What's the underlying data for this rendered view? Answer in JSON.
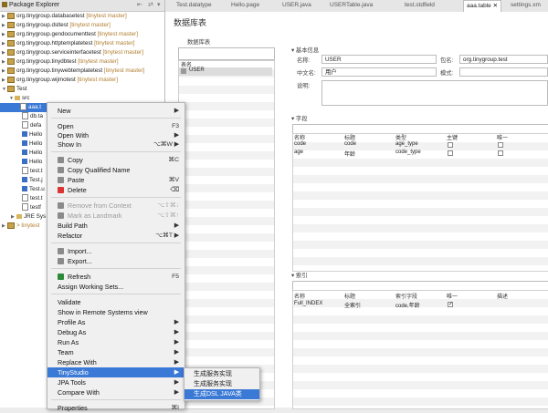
{
  "package_explorer": {
    "title": "Package Explorer",
    "rows": [
      {
        "name": "org.tinygroup.databasetest",
        "branch": "[tinytest master]"
      },
      {
        "name": "org.tinygroup.dsltest",
        "branch": "[tinytest master]"
      },
      {
        "name": "org.tinygroup.gendocumenttest",
        "branch": "[tinytest master]"
      },
      {
        "name": "org.tinygroup.httptemplatetest",
        "branch": "[tinytest master]"
      },
      {
        "name": "org.tinygroup.serviceinterfacetest",
        "branch": "[tinytest master]"
      },
      {
        "name": "org.tinygroup.tinydbtest",
        "branch": "[tinytest master]"
      },
      {
        "name": "org.tinygroup.tinywebtemplatetest",
        "branch": "[tinytest master]"
      },
      {
        "name": "org.tinygroup.wijmotest",
        "branch": "[tinytest master]"
      }
    ],
    "test_project": "Test",
    "src_folder": "src",
    "selected_file": "aaa.t",
    "children": [
      "db.ta",
      "defa",
      "Hello",
      "Hello",
      "Hello",
      "Hello",
      "test.t",
      "Test.j",
      "Test.u",
      "test.t",
      "testf"
    ],
    "jre": "JRE Sys",
    "tinytest": "> tinytest"
  },
  "editor_tabs": [
    "Test.datatype",
    "Hello.page",
    "USER.java",
    "USERTable.java",
    "test.stdfield",
    "aaa.table",
    "settings.xm"
  ],
  "editor": {
    "title": "数据库表",
    "left_section": "数据库表",
    "list_header": "表名",
    "list_item": "USER",
    "basic_section": "基本信息",
    "name_label": "名称:",
    "name_value": "USER",
    "package_label": "包名:",
    "package_value": "org.tinygroup.test",
    "cn_label": "中文名:",
    "cn_value": "用户",
    "mode_label": "模式:",
    "desc_label": "说明:",
    "field_section": "字段",
    "field_columns": [
      "名称",
      "标题",
      "类型",
      "主键",
      "唯一"
    ],
    "field_rows": [
      {
        "name": "code",
        "title": "code",
        "type": "age_type"
      },
      {
        "name": "age",
        "title": "年龄",
        "type": "code_type"
      }
    ],
    "index_section": "索引",
    "index_columns": [
      "名称",
      "标题",
      "索引字段",
      "唯一",
      "描述"
    ],
    "index_rows": [
      {
        "name": "Full_INDEX",
        "title": "全索引",
        "fields": "code,年龄"
      }
    ]
  },
  "context_menu": {
    "items": [
      {
        "label": "New",
        "shortcut": "▶"
      },
      {
        "label": "Open",
        "shortcut": "F3"
      },
      {
        "label": "Open With",
        "shortcut": "▶"
      },
      {
        "label": "Show In",
        "shortcut": "⌥⌘W ▶"
      },
      {
        "label": "Copy",
        "shortcut": "⌘C"
      },
      {
        "label": "Copy Qualified Name",
        "shortcut": ""
      },
      {
        "label": "Paste",
        "shortcut": "⌘V"
      },
      {
        "label": "Delete",
        "shortcut": "⌫"
      },
      {
        "label": "Remove from Context",
        "shortcut": "⌥⇧⌘↓"
      },
      {
        "label": "Mark as Landmark",
        "shortcut": "⌥⇧⌘↑"
      },
      {
        "label": "Build Path",
        "shortcut": "▶"
      },
      {
        "label": "Refactor",
        "shortcut": "⌥⌘T ▶"
      },
      {
        "label": "Import...",
        "shortcut": ""
      },
      {
        "label": "Export...",
        "shortcut": ""
      },
      {
        "label": "Refresh",
        "shortcut": "F5"
      },
      {
        "label": "Assign Working Sets...",
        "shortcut": ""
      },
      {
        "label": "Validate",
        "shortcut": ""
      },
      {
        "label": "Show in Remote Systems view",
        "shortcut": ""
      },
      {
        "label": "Profile As",
        "shortcut": "▶"
      },
      {
        "label": "Debug As",
        "shortcut": "▶"
      },
      {
        "label": "Run As",
        "shortcut": "▶"
      },
      {
        "label": "Team",
        "shortcut": "▶"
      },
      {
        "label": "Replace With",
        "shortcut": "▶"
      },
      {
        "label": "TinyStudio",
        "shortcut": "▶"
      },
      {
        "label": "JPA Tools",
        "shortcut": "▶"
      },
      {
        "label": "Compare With",
        "shortcut": "▶"
      },
      {
        "label": "Properties",
        "shortcut": "⌘I"
      }
    ]
  },
  "submenu": {
    "items": [
      "生成服务实现",
      "生成服务实现",
      "生成DSL JAVA类"
    ]
  },
  "colors": {
    "highlight": "#3a79d6",
    "branch": "#b07c2e"
  }
}
